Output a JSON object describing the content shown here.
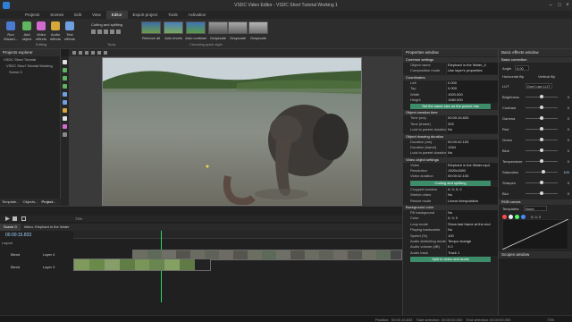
{
  "window": {
    "title": "VSDC Video Editor - VSDC Short Tutorial Working 1"
  },
  "menu": [
    "Projects",
    "Scenes",
    "Edit",
    "View",
    "Editor",
    "Export project",
    "Tools",
    "Activation"
  ],
  "menu_active": "Editor",
  "ribbon": {
    "run_wizard": "Run Wizard...",
    "add_object": "Add object",
    "video_effects": "Video effects",
    "audio_effects": "Audio effects",
    "text_effects": "Text effects",
    "editing_label": "Editing",
    "cutting_splitting": "Cutting and splitting",
    "tools_label": "Tools",
    "quick_styles": [
      "Remove all",
      "Auto levels",
      "Auto contrast",
      "Grayscale",
      "Grayscale",
      "Grayscale"
    ],
    "quick_style_label": "Choosing quick style"
  },
  "explorer": {
    "title": "Projects explorer",
    "items": [
      "VSDC Short Tutorial",
      "VSDC Short Tutorial Working",
      "Scene 0"
    ]
  },
  "bottom_tabs": [
    "Template...",
    "Objects...",
    "Project..."
  ],
  "canvas": {
    "zoom": "73%"
  },
  "properties": {
    "title": "Properties window",
    "common_settings": "Common settings",
    "rows_top": [
      {
        "k": "Object name",
        "v": "Elephant in the Water_4"
      },
      {
        "k": "Composition mode",
        "v": "Use layer's properties"
      }
    ],
    "coordinates": "Coordinates",
    "coord_rows": [
      {
        "k": "Left",
        "v": "0.000"
      },
      {
        "k": "Top",
        "v": "0.000"
      },
      {
        "k": "Width",
        "v": "1920.000"
      },
      {
        "k": "Height",
        "v": "1080.000"
      }
    ],
    "set_same_size": "Set the same size as the parent has",
    "creation_time": "Object creation time",
    "creation_rows": [
      {
        "k": "Time (ms)",
        "v": "00:00:15.833"
      },
      {
        "k": "Time (frame)",
        "v": "325"
      },
      {
        "k": "Lock to parent duration",
        "v": "No"
      }
    ],
    "drawing_duration": "Object drawing duration",
    "duration_rows": [
      {
        "k": "Duration (ms)",
        "v": "00:00:42.153"
      },
      {
        "k": "Duration (frame)",
        "v": "1264"
      },
      {
        "k": "Lock to parent duration",
        "v": "No"
      }
    ],
    "video_settings": "Video object settings",
    "video_rows": [
      {
        "k": "Video",
        "v": "Elephant in the Water.mp4"
      },
      {
        "k": "Resolution",
        "v": "1920x1080"
      },
      {
        "k": "Video duration",
        "v": "00:00:42.153"
      }
    ],
    "cutting_btn": "Cutting and splitting",
    "video_rows2": [
      {
        "k": "Cropped borders",
        "v": "0; 0; 0; 0"
      },
      {
        "k": "Stretch video",
        "v": "No"
      },
      {
        "k": "Resize mode",
        "v": "Linear interpolation"
      }
    ],
    "background_color": "Background color",
    "bg_rows": [
      {
        "k": "Fill background",
        "v": "No"
      },
      {
        "k": "Color",
        "v": "0; 0; 0"
      },
      {
        "k": "Loop mode",
        "v": "Show last frame at the end"
      },
      {
        "k": "Playing backwards",
        "v": "No"
      },
      {
        "k": "Speed (%)",
        "v": "100"
      },
      {
        "k": "Audio stretching mode",
        "v": "Tempo change"
      },
      {
        "k": "Audio volume (dB)",
        "v": "0.0"
      },
      {
        "k": "Audio track",
        "v": "Track 1"
      }
    ],
    "split_btn": "Split to video and audio",
    "tabs": [
      "Resources window",
      "Properties window"
    ]
  },
  "effects": {
    "title": "Basic effects window",
    "section": "Basic correction",
    "angle_label": "Angle",
    "angle_value": "0.00",
    "flip_h": "Horizontal flip",
    "flip_v": "Vertical flip",
    "lut_label": "LUT",
    "lut_value": "Don't use LUT",
    "sliders": [
      {
        "label": "Brightness",
        "value": "0",
        "pos": 0.5
      },
      {
        "label": "Contrast",
        "value": "0",
        "pos": 0.5
      },
      {
        "label": "Gamma",
        "value": "0",
        "pos": 0.5
      },
      {
        "label": "Red",
        "value": "0",
        "pos": 0.5
      },
      {
        "label": "Green",
        "value": "0",
        "pos": 0.5
      },
      {
        "label": "Blue",
        "value": "0",
        "pos": 0.5
      },
      {
        "label": "Temperature",
        "value": "0",
        "pos": 0.5
      },
      {
        "label": "Saturation",
        "value": "100",
        "pos": 0.55
      },
      {
        "label": "Sharpen",
        "value": "0",
        "pos": 0.5
      },
      {
        "label": "Blur",
        "value": "0",
        "pos": 0.5
      }
    ],
    "rgb_curves": "RGB curves",
    "templates_label": "Templates:",
    "templates_value": "None",
    "curve_readout": "0; 0; 0"
  },
  "scopes": {
    "title": "Scopes window"
  },
  "timeline": {
    "tabs": [
      "Scene 0",
      "Video: Elephant in the Water"
    ],
    "time_readout": "00:00:15.833",
    "layout_label": "Layout",
    "tracks": [
      {
        "mode": "Blend",
        "name": "Layer 4"
      },
      {
        "mode": "Blend",
        "name": "Layer 3"
      }
    ]
  },
  "status": {
    "position_label": "Position:",
    "position_value": "00:00:15.833",
    "start_label": "Start selection:",
    "start_value": "00:00:00.000",
    "end_label": "End selection:",
    "end_value": "00:00:00.000",
    "zoom_value": "73%"
  },
  "colors": {
    "accent": "#3d8c6a",
    "selection_blue": "#2f7fd6",
    "playhead": "#2fd66a"
  }
}
